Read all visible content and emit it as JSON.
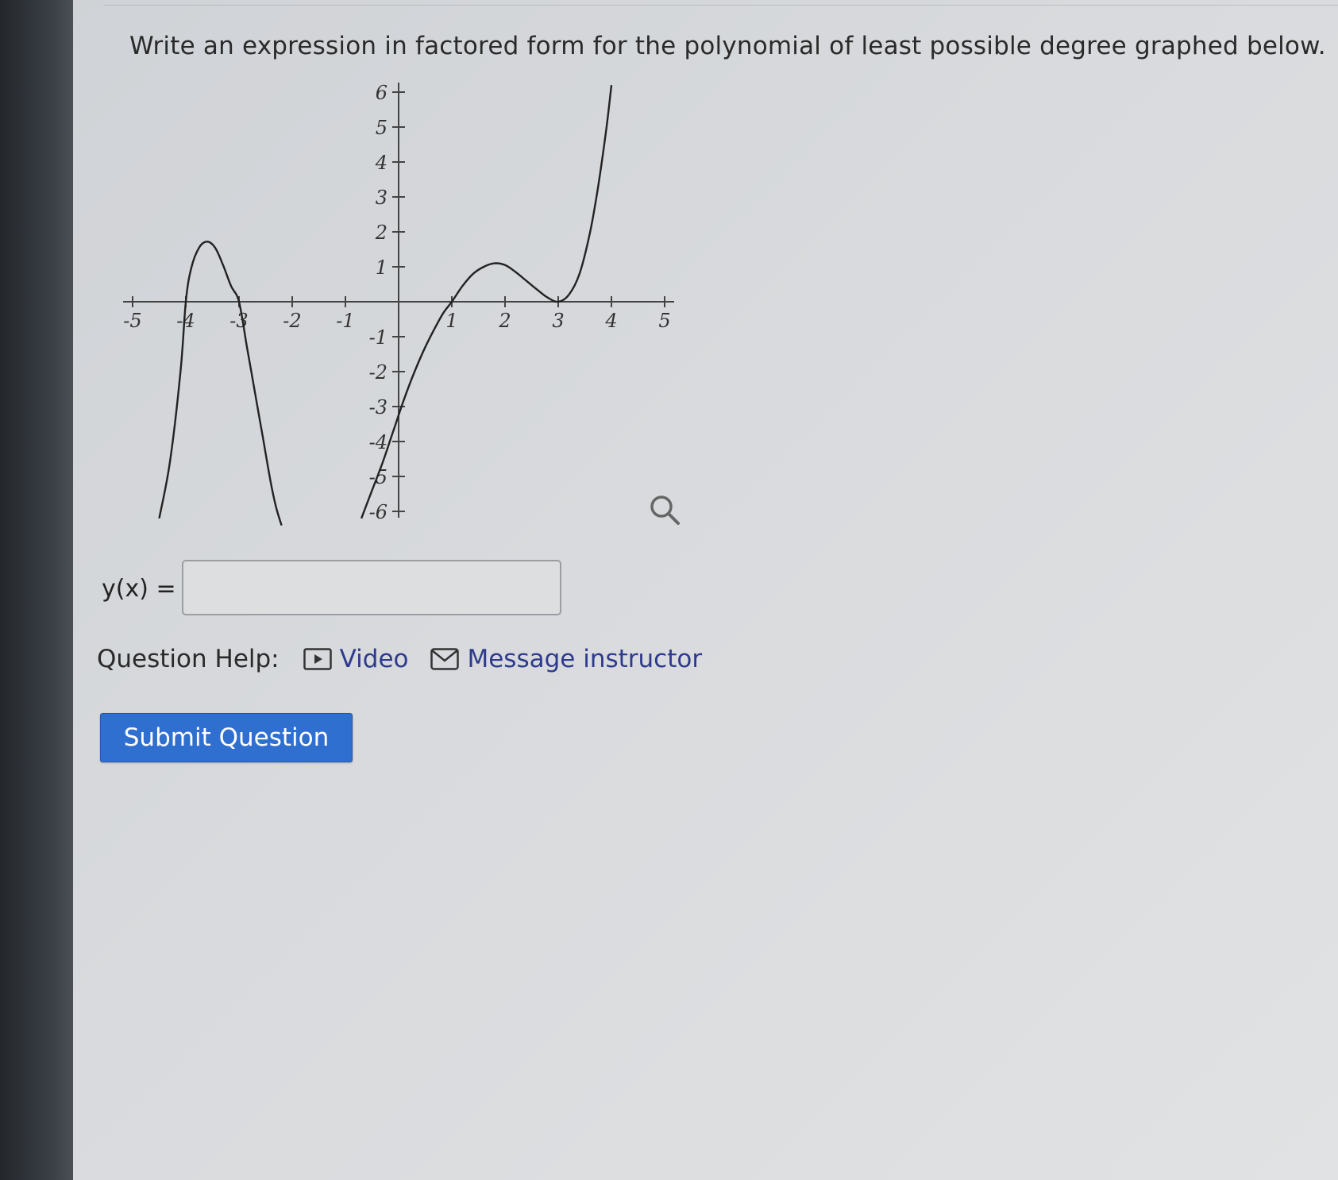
{
  "question": {
    "prompt": "Write an expression in factored form for the polynomial of least possible degree graphed below."
  },
  "chart_data": {
    "type": "line",
    "x_ticks": [
      "-5",
      "-4",
      "-3",
      "-2",
      "-1",
      "1",
      "2",
      "3",
      "4",
      "5"
    ],
    "y_ticks": [
      "6",
      "5",
      "4",
      "3",
      "2",
      "1",
      "-1",
      "-2",
      "-3",
      "-4",
      "-5",
      "-6"
    ],
    "xlim": [
      -5,
      5
    ],
    "ylim": [
      -6,
      6
    ],
    "grid": false,
    "series": [
      {
        "x": [
          -4.5,
          -4.3,
          -4.1,
          -4.0,
          -3.9,
          -3.75,
          -3.6,
          -3.45,
          -3.3,
          -3.15,
          -3.0,
          -2.85,
          -2.7,
          -2.55,
          -2.4,
          -2.3,
          -2.2
        ],
        "y": [
          -6.2,
          -4.6,
          -2.0,
          0,
          0.95,
          1.55,
          1.72,
          1.55,
          1.05,
          0.45,
          0,
          -1.3,
          -2.6,
          -3.9,
          -5.2,
          -5.9,
          -6.4
        ]
      },
      {
        "x": [
          -0.7,
          -0.5,
          -0.3,
          -0.1,
          0.1,
          0.3,
          0.5,
          0.7,
          0.85,
          1.0,
          1.2,
          1.4,
          1.6,
          1.8,
          2.0,
          2.2,
          2.4,
          2.6,
          2.8,
          3.0,
          3.2,
          3.4,
          3.6,
          3.75,
          3.9,
          4.0
        ],
        "y": [
          -6.2,
          -5.4,
          -4.6,
          -3.7,
          -2.8,
          -2.0,
          -1.3,
          -0.7,
          -0.3,
          0,
          0.45,
          0.8,
          1.0,
          1.1,
          1.05,
          0.85,
          0.6,
          0.35,
          0.12,
          0,
          0.2,
          0.8,
          2.0,
          3.3,
          4.9,
          6.2
        ]
      }
    ]
  },
  "answer": {
    "label": "y(x) =",
    "value": ""
  },
  "help": {
    "label": "Question Help:",
    "video_label": "Video",
    "message_label": "Message instructor"
  },
  "submit_label": "Submit Question"
}
